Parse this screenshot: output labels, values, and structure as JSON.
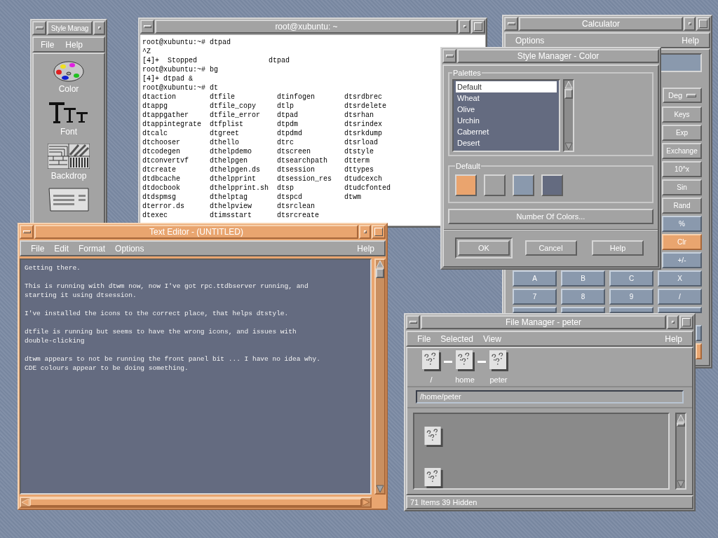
{
  "windows": [
    {
      "kind": "style_manager",
      "title": "Style Manag",
      "active": false,
      "menu": [
        {
          "label": "File"
        },
        {
          "label": "Help"
        }
      ],
      "tools": [
        {
          "kind": "color",
          "label": "Color"
        },
        {
          "kind": "font",
          "label": "Font"
        },
        {
          "kind": "backdrop",
          "label": "Backdrop"
        },
        {
          "kind": "keyboard"
        }
      ]
    },
    {
      "kind": "terminal",
      "title": "root@xubuntu: ~",
      "active": false,
      "lines": [
        "root@xubuntu:~# dtpad",
        "^Z",
        "[4]+  Stopped                 dtpad",
        "root@xubuntu:~# bg",
        "[4]+ dtpad &",
        "root@xubuntu:~# dt"
      ],
      "listing": [
        [
          "dtaction",
          "dtfile",
          "dtinfogen",
          "dtsrdbrec"
        ],
        [
          "dtappg",
          "dtfile_copy",
          "dtlp",
          "dtsrdelete"
        ],
        [
          "dtappgather",
          "dtfile_error",
          "dtpad",
          "dtsrhan"
        ],
        [
          "dtappintegrate",
          "dtfplist",
          "dtpdm",
          "dtsrindex"
        ],
        [
          "dtcalc",
          "dtgreet",
          "dtpdmd",
          "dtsrkdump"
        ],
        [
          "dtchooser",
          "dthello",
          "dtrc",
          "dtsrload"
        ],
        [
          "dtcodegen",
          "dthelpdemo",
          "dtscreen",
          "dtstyle"
        ],
        [
          "dtconvertvf",
          "dthelpgen",
          "dtsearchpath",
          "dtterm"
        ],
        [
          "dtcreate",
          "dthelpgen.ds",
          "dtsession",
          "dttypes"
        ],
        [
          "dtdbcache",
          "dthelpprint",
          "dtsession_res",
          "dtudcexch"
        ],
        [
          "dtdocbook",
          "dthelpprint.sh",
          "dtsp",
          "dtudcfonted"
        ],
        [
          "dtdspmsg",
          "dthelptag",
          "dtspcd",
          "dtwm"
        ],
        [
          "dterror.ds",
          "dthelpview",
          "dtsrclean"
        ],
        [
          "dtexec",
          "dtimsstart",
          "dtsrcreate"
        ]
      ]
    },
    {
      "kind": "calculator",
      "title": "Calculator",
      "active": false,
      "menu": [
        {
          "label": "Options"
        }
      ],
      "help_menu": {
        "label": "Help"
      },
      "mode": "Deg",
      "keys": [
        [
          {
            "kind": "function",
            "label": "Keys"
          }
        ],
        [
          {
            "kind": "function",
            "label": "Exp"
          }
        ],
        [
          {
            "kind": "function",
            "label": "Exchange"
          }
        ],
        [
          {
            "kind": "function",
            "label": "10^x"
          }
        ],
        [
          {
            "kind": "function",
            "label": "Sin"
          }
        ],
        [
          {
            "kind": "function",
            "label": "Rand"
          }
        ],
        [
          {
            "kind": "operator",
            "label": "%"
          }
        ],
        [
          {
            "kind": "clear",
            "label": "Clr"
          }
        ],
        [
          {
            "kind": "operator",
            "label": "+/-"
          }
        ],
        [
          {
            "kind": "digit",
            "label": "A"
          },
          {
            "kind": "digit",
            "label": "B"
          },
          {
            "kind": "digit",
            "label": "C"
          },
          {
            "kind": "operator",
            "label": "X"
          }
        ],
        [
          {
            "kind": "digit",
            "label": "7"
          },
          {
            "kind": "digit",
            "label": "8"
          },
          {
            "kind": "digit",
            "label": "9"
          },
          {
            "kind": "operator",
            "label": "/"
          }
        ],
        [
          {
            "kind": "digit"
          },
          {
            "kind": "digit"
          },
          {
            "kind": "digit"
          },
          {
            "kind": "operator"
          }
        ],
        [
          {
            "kind": "operator"
          }
        ],
        [
          {
            "kind": "clear"
          }
        ]
      ]
    },
    {
      "kind": "style_color",
      "title": "Style Manager - Color",
      "active": false,
      "palettes_label": "Palettes",
      "palettes": [
        {
          "label": "Default",
          "selected": true
        },
        {
          "label": "Wheat",
          "selected": false
        },
        {
          "label": "Olive",
          "selected": false
        },
        {
          "label": "Urchin",
          "selected": false
        },
        {
          "label": "Cabernet",
          "selected": false
        },
        {
          "label": "Desert",
          "selected": false
        }
      ],
      "swatch_group": "Default",
      "swatches": [
        {
          "color": "#eaa46e"
        },
        {
          "color": "#a2a2a2"
        },
        {
          "color": "#8a99ad"
        },
        {
          "color": "#646b80"
        }
      ],
      "colors_button": "Number Of Colors...",
      "buttons": [
        {
          "label": "OK",
          "default": true
        },
        {
          "label": "Cancel",
          "default": false
        },
        {
          "label": "Help",
          "default": false
        }
      ]
    },
    {
      "kind": "text_editor",
      "title": "Text Editor - (UNTITLED)",
      "active": true,
      "menu": [
        {
          "label": "File"
        },
        {
          "label": "Edit"
        },
        {
          "label": "Format"
        },
        {
          "label": "Options"
        }
      ],
      "help_menu": {
        "label": "Help"
      },
      "paragraphs": [
        [
          "Getting there."
        ],
        [
          "This is running with dtwm now, now I've got rpc.ttdbserver running, and",
          "starting it using dtsession."
        ],
        [
          "I've installed the icons to the correct place, that helps dtstyle."
        ],
        [
          "dtfile is running but seems to have the wrong icons, and issues with",
          "double-clicking"
        ],
        [
          "dtwm appears to not be running the front panel bit ... I have no idea why.",
          "CDE colours appear to be doing something."
        ]
      ]
    },
    {
      "kind": "file_manager",
      "title": "File Manager - peter",
      "active": false,
      "menu": [
        {
          "label": "File"
        },
        {
          "label": "Selected"
        },
        {
          "label": "View"
        }
      ],
      "help_menu": {
        "label": "Help"
      },
      "path_icons": [
        {
          "label": "/"
        },
        {
          "label": "home"
        },
        {
          "label": "peter"
        }
      ],
      "path": "/home/peter",
      "files": [
        {
          "kind": "unknown"
        },
        {
          "kind": "unknown"
        }
      ],
      "status": "71 Items 39 Hidden"
    }
  ]
}
